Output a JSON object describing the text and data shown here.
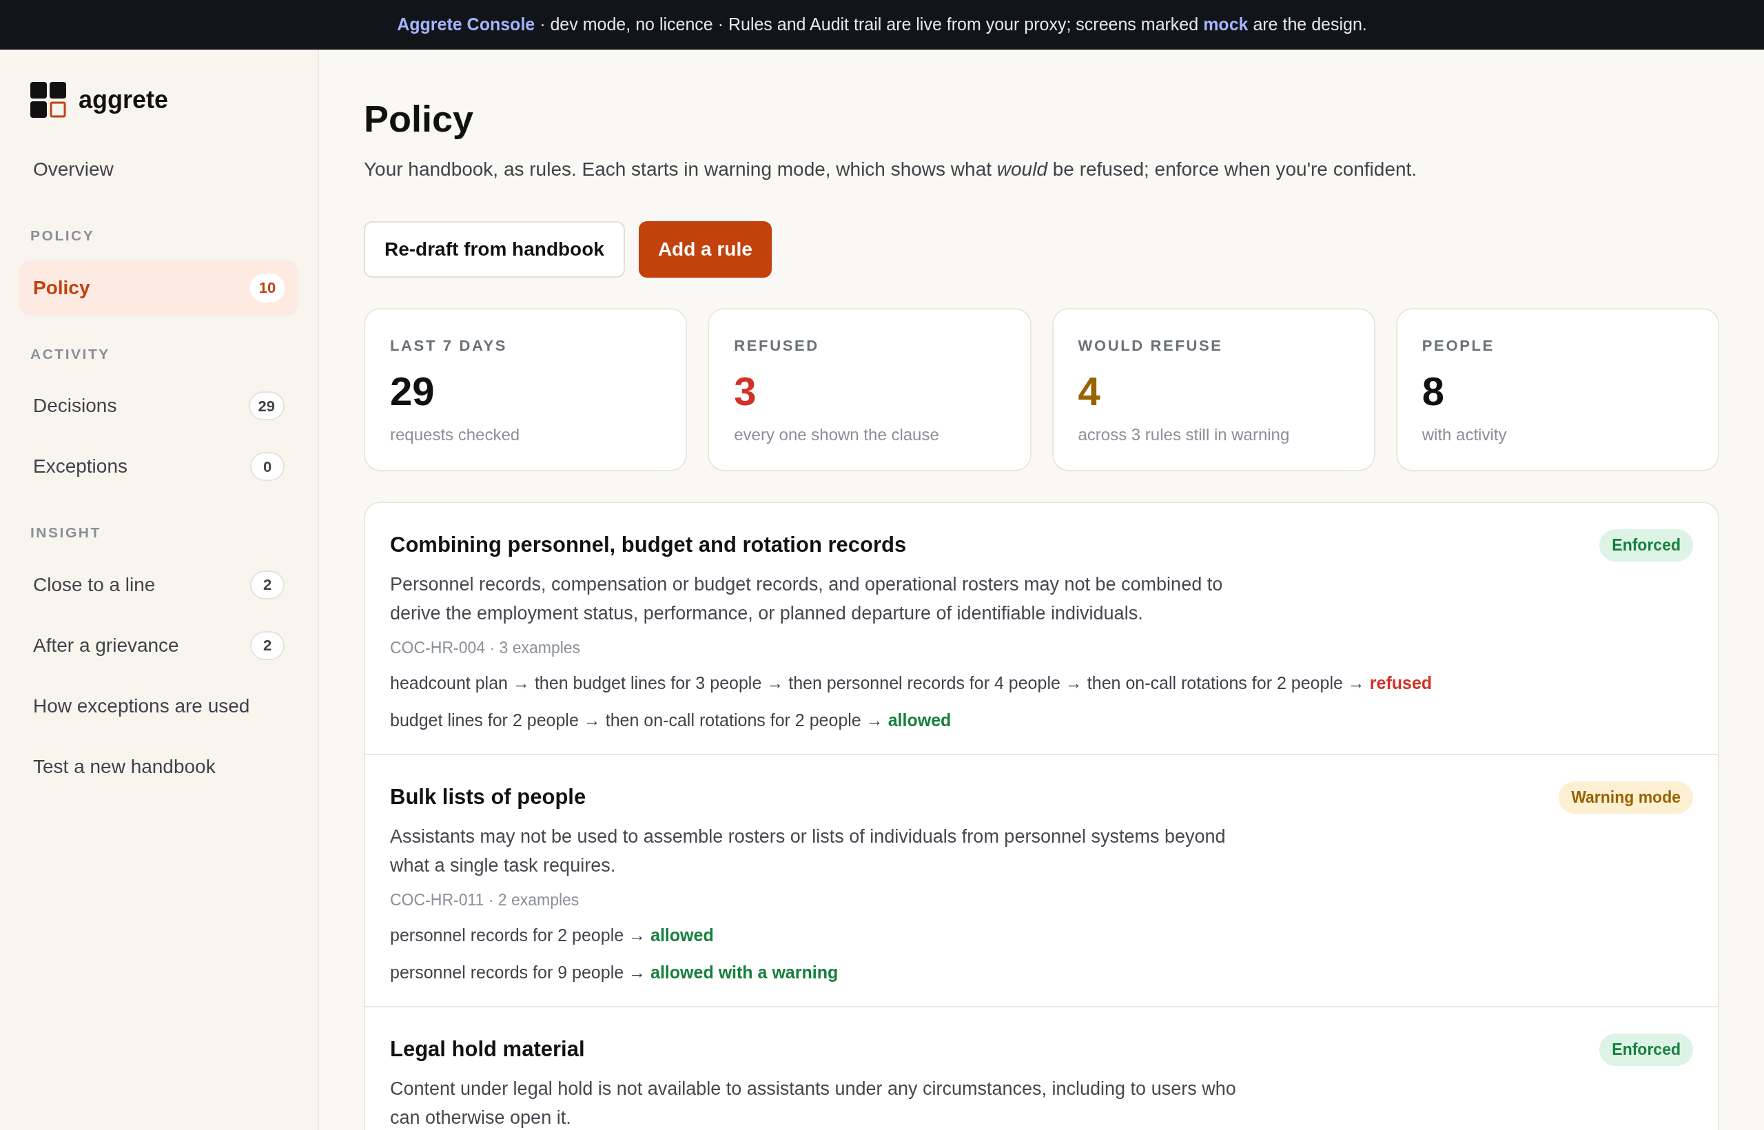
{
  "banner": {
    "brand": "Aggrete Console",
    "text_before": " · dev mode, no licence · Rules and Audit trail are live from your proxy; screens marked ",
    "highlight": "mock",
    "text_after": " are the design."
  },
  "sidebar": {
    "logo": "aggrete",
    "items": [
      {
        "kind": "item",
        "label": "Overview",
        "selected": false
      },
      {
        "kind": "section",
        "label": "POLICY"
      },
      {
        "kind": "item",
        "label": "Policy",
        "count": "10",
        "selected": true
      },
      {
        "kind": "section",
        "label": "ACTIVITY"
      },
      {
        "kind": "item",
        "label": "Decisions",
        "count": "29",
        "selected": false
      },
      {
        "kind": "item",
        "label": "Exceptions",
        "count": "0",
        "selected": false
      },
      {
        "kind": "section",
        "label": "INSIGHT"
      },
      {
        "kind": "item",
        "label": "Close to a line",
        "count": "2",
        "selected": false
      },
      {
        "kind": "item",
        "label": "After a grievance",
        "count": "2",
        "selected": false
      },
      {
        "kind": "item",
        "label": "How exceptions are used",
        "selected": false
      },
      {
        "kind": "item",
        "label": "Test a new handbook",
        "selected": false
      }
    ]
  },
  "page": {
    "title": "Policy",
    "subtitle": "Your handbook, as rules. Each starts in warning mode, which shows what *would* be refused; enforce when you're confident.",
    "buttons": [
      {
        "kind": "secondary",
        "label": "Re-draft from handbook"
      },
      {
        "kind": "primary",
        "label": "Add a rule"
      }
    ]
  },
  "stats": [
    {
      "label": "LAST 7 DAYS",
      "value": "29",
      "note": "requests checked",
      "color": "#111111"
    },
    {
      "label": "REFUSED",
      "value": "3",
      "note": "every one shown the clause",
      "color": "#d33126"
    },
    {
      "label": "WOULD REFUSE",
      "value": "4",
      "note": "across 3 rules still in warning",
      "color": "#9a6200"
    },
    {
      "label": "PEOPLE",
      "value": "8",
      "note": "with activity",
      "color": "#111111"
    }
  ],
  "rules": [
    {
      "title": "Combining personnel, budget and rotation records",
      "status": {
        "kind": "enforced",
        "label": "Enforced"
      },
      "description": "Personnel records, compensation or budget records, and operational rosters may not be combined to derive the employment status, performance, or planned departure of identifiable individuals.",
      "meta": "COC-HR-004 · 3 examples",
      "examples": [
        {
          "path": "headcount plan → then budget lines for 3 people → then personnel records for 4 people → then on-call rotations for 2 people →",
          "outcome": {
            "kind": "refused",
            "label": "refused"
          }
        },
        {
          "path": "budget lines for 2 people → then on-call rotations for 2 people →",
          "outcome": {
            "kind": "allowed",
            "label": "allowed"
          }
        }
      ]
    },
    {
      "title": "Bulk lists of people",
      "status": {
        "kind": "warning",
        "label": "Warning mode"
      },
      "description": "Assistants may not be used to assemble rosters or lists of individuals from personnel systems beyond what a single task requires.",
      "meta": "COC-HR-011 · 2 examples",
      "examples": [
        {
          "path": "personnel records for 2 people →",
          "outcome": {
            "kind": "allowed",
            "label": "allowed"
          }
        },
        {
          "path": "personnel records for 9 people →",
          "outcome": {
            "kind": "allowed",
            "label": "allowed with a warning"
          }
        }
      ]
    },
    {
      "title": "Legal hold material",
      "status": {
        "kind": "enforced",
        "label": "Enforced"
      },
      "description": "Content under legal hold is not available to assistants under any circumstances, including to users who can otherwise open it."
    }
  ]
}
